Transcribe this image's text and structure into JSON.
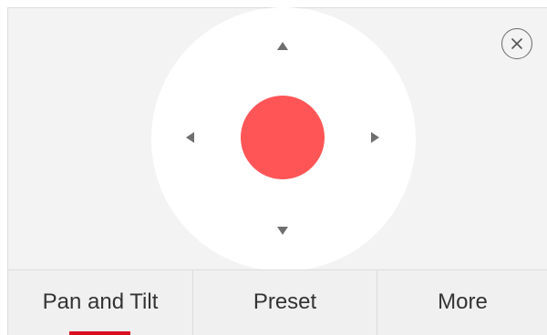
{
  "controls": {
    "up_icon": "arrow-up-icon",
    "down_icon": "arrow-down-icon",
    "left_icon": "arrow-left-icon",
    "right_icon": "arrow-right-icon",
    "center_icon": "center-button",
    "close_icon": "close-icon"
  },
  "tabs": [
    {
      "label": "Pan and Tilt",
      "active": true
    },
    {
      "label": "Preset",
      "active": false
    },
    {
      "label": "More",
      "active": false
    }
  ],
  "colors": {
    "accent": "#ff5556",
    "active_tab_indicator": "#d90f1f",
    "background": "#f3f3f3",
    "pad": "#ffffff",
    "icon": "#6f6f6f"
  }
}
